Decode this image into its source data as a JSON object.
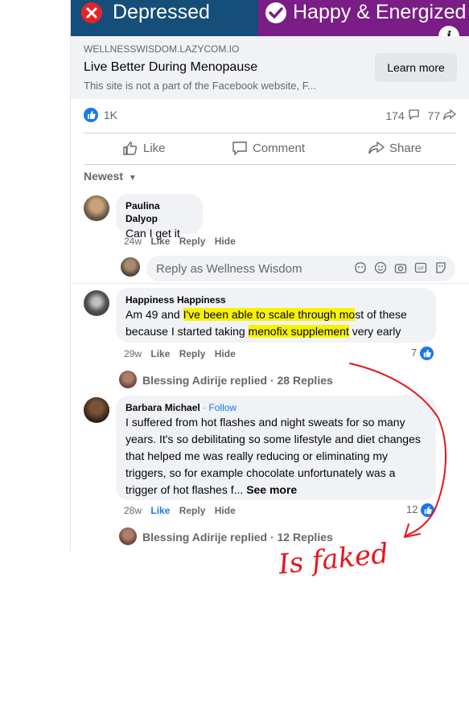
{
  "banner": {
    "left_label": "Depressed",
    "right_label": "Happy & Energized",
    "left_color": "#164e7a",
    "right_color": "#7a1d86"
  },
  "ad": {
    "domain": "WELLNESSWISDOM.LAZYCOM.IO",
    "title": "Live Better During Menopause",
    "subtitle": "This site is not a part of the Facebook website, F...",
    "cta": "Learn more"
  },
  "stats": {
    "likes": "1K",
    "comments": "174",
    "shares": "77"
  },
  "actions": {
    "like": "Like",
    "comment": "Comment",
    "share": "Share"
  },
  "sort_label": "Newest",
  "comments": [
    {
      "name": "Paulina Dalyop",
      "text": "Can I get it",
      "time": "24w",
      "like": "Like",
      "reply": "Reply",
      "hide": "Hide"
    },
    {
      "name": "Happiness Happiness",
      "text_parts": [
        "Am 49 and ",
        "I've been able to scale through mo",
        "st of these",
        "because I started taking ",
        "menofix supplement",
        " very early"
      ],
      "time": "29w",
      "like": "Like",
      "reply": "Reply",
      "hide": "Hide",
      "reactions": "7",
      "replies": "Blessing Adirije replied · 28 Replies"
    },
    {
      "name": "Barbara Michael",
      "follow": "· Follow",
      "text": "I suffered from hot flashes and night sweats for so many years. It's so debilitating so some lifestyle and diet changes that helped me was really reducing or eliminating my triggers, so for example chocolate unfortunately was a trigger of hot flashes f...",
      "see_more": "See more",
      "time": "28w",
      "like": "Like",
      "reply": "Reply",
      "hide": "Hide",
      "reactions": "12",
      "replies": "Blessing Adirije replied · 12 Replies"
    }
  ],
  "reply_box": {
    "placeholder": "Reply as Wellness Wisdom"
  },
  "annotation": {
    "text": "Is faked",
    "color": "#e8141c"
  }
}
